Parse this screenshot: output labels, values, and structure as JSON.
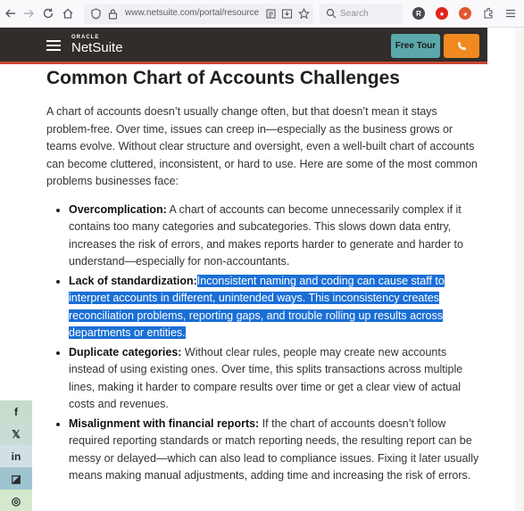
{
  "browser": {
    "url": "www.netsuite.com/portal/resource/",
    "search_placeholder": "Search"
  },
  "header": {
    "logo_top": "ORACLE",
    "logo_main": "NetSuite",
    "free_tour": "Free Tour",
    "phone_icon": "phone-icon"
  },
  "article": {
    "title": "Common Chart of Accounts Challenges",
    "intro": "A chart of accounts doesn’t usually change often, but that doesn’t mean it stays problem-free. Over time, issues can creep in—especially as the business grows or teams evolve. Without clear structure and oversight, even a well-built chart of accounts can become cluttered, inconsistent, or hard to use. Here are some of the most common problems businesses face:",
    "items": [
      {
        "term": "Overcomplication:",
        "text": " A chart of accounts can become unnecessarily complex if it contains too many categories and subcategories. This slows down data entry, increases the risk of errors, and makes reports harder to generate and harder to understand—especially for non-accountants."
      },
      {
        "term": "Lack of standardization:",
        "text": "Inconsistent naming and coding can cause staff to interpret accounts in different, unintended ways. This inconsistency creates reconciliation problems, reporting gaps, and trouble rolling up results across departments or entities."
      },
      {
        "term": "Duplicate categories:",
        "text": " Without clear rules, people may create new accounts instead of using existing ones. Over time, this splits transactions across multiple lines, making it harder to compare results over time or get a clear view of actual costs and revenues."
      },
      {
        "term": "Misalignment with financial reports:",
        "text": " If the chart of accounts doesn’t follow required reporting standards or match reporting needs, the resulting report can be messy or delayed—which can also lead to compliance issues. Fixing it later usually means making manual adjustments, adding time and increasing the risk of errors."
      }
    ]
  },
  "social": [
    {
      "label": "f",
      "icon": "facebook-icon",
      "color": "#c8dccb"
    },
    {
      "label": "𝕏",
      "icon": "x-icon",
      "color": "#c9dcd5"
    },
    {
      "label": "in",
      "icon": "linkedin-icon",
      "color": "#d2dfe4"
    },
    {
      "label": "◪",
      "icon": "flipboard-icon",
      "color": "#9ec4cf"
    },
    {
      "label": "◎",
      "icon": "instagram-icon",
      "color": "#d3e8cc"
    }
  ],
  "colors": {
    "header_bg": "#312d2a",
    "accent_red": "#c74634",
    "free_tour_bg": "#5aa8aa",
    "phone_bg": "#f08a20",
    "highlight": "#1a6fd6"
  }
}
